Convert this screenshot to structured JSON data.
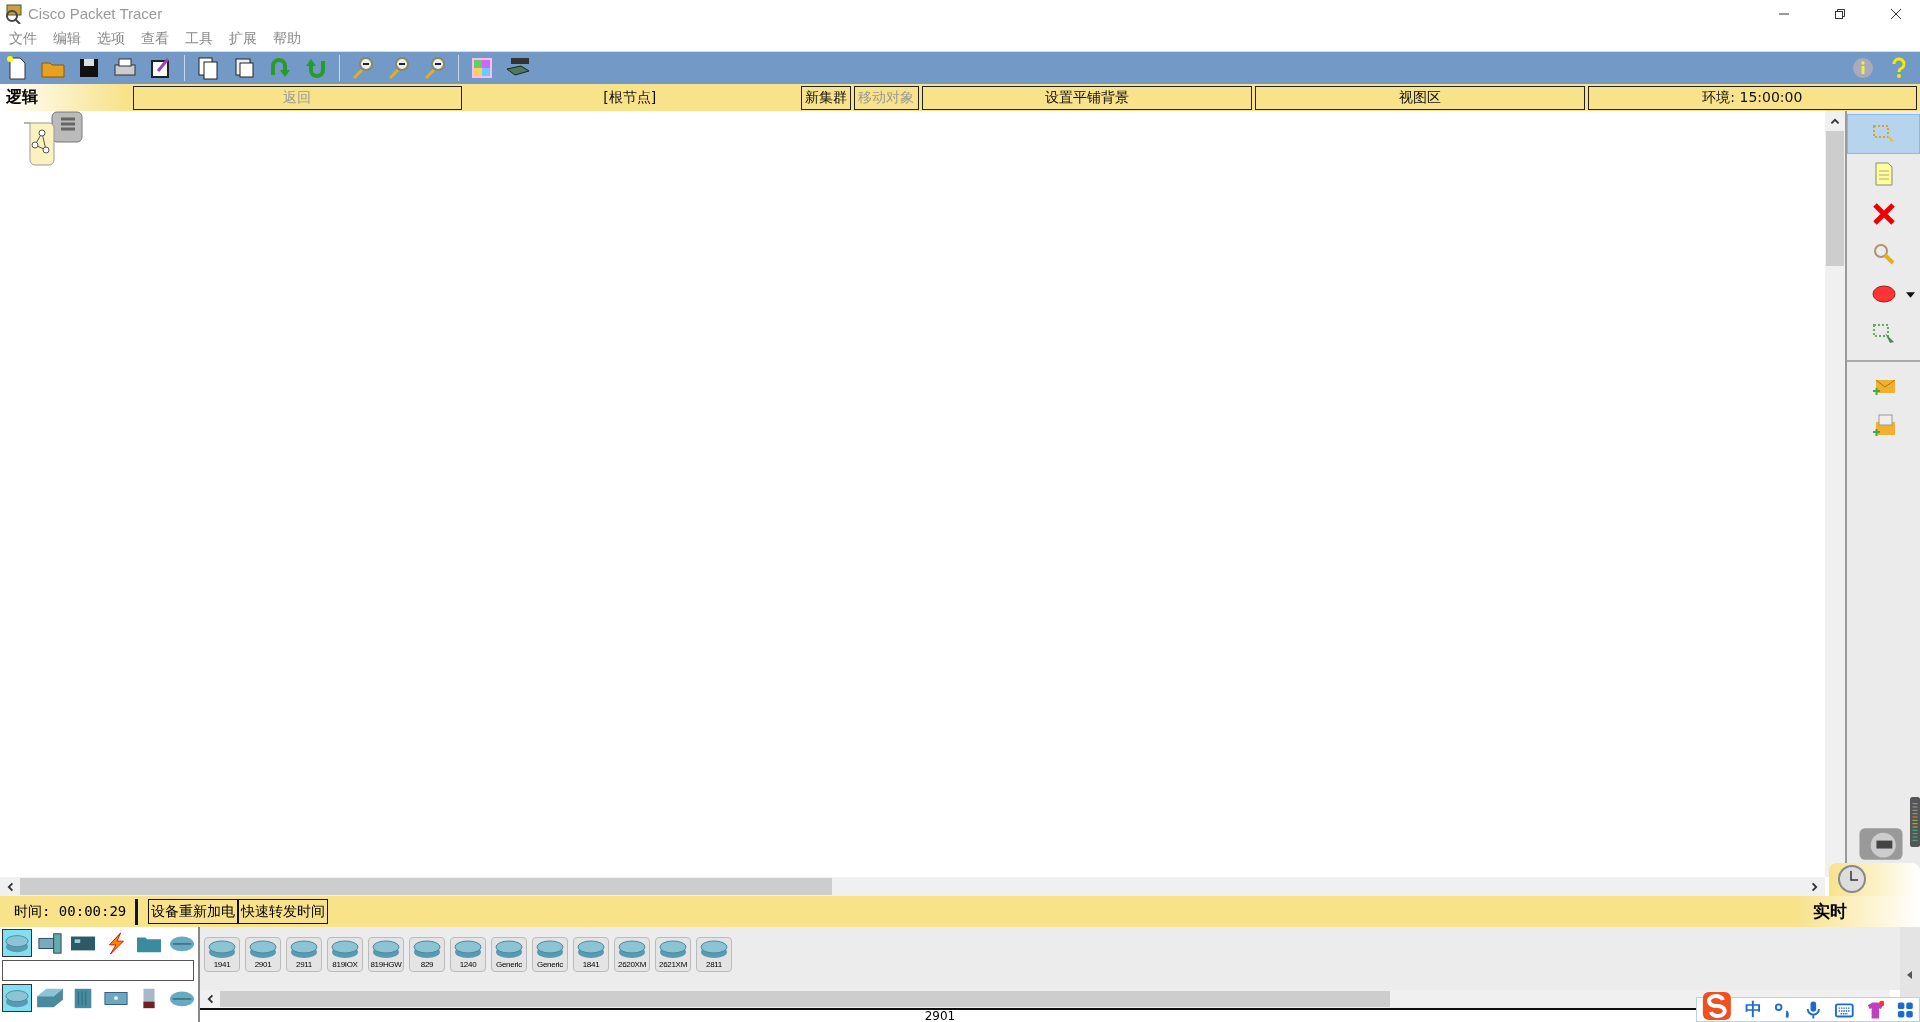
{
  "window": {
    "title": "Cisco Packet Tracer"
  },
  "menu": [
    "文件",
    "编辑",
    "选项",
    "查看",
    "工具",
    "扩展",
    "帮助"
  ],
  "toolbar": [
    {
      "kind": "new"
    },
    {
      "kind": "open"
    },
    {
      "kind": "save"
    },
    {
      "kind": "print"
    },
    {
      "kind": "wizard"
    },
    {
      "kind": "sep"
    },
    {
      "kind": "copy"
    },
    {
      "kind": "paste"
    },
    {
      "kind": "undo"
    },
    {
      "kind": "redo"
    },
    {
      "kind": "sep"
    },
    {
      "kind": "zoomin"
    },
    {
      "kind": "zoomreset"
    },
    {
      "kind": "zoomout"
    },
    {
      "kind": "sep"
    },
    {
      "kind": "palette"
    },
    {
      "kind": "device"
    }
  ],
  "nav_bar": {
    "workspace_tab": "逻辑",
    "items": [
      {
        "kind": "button",
        "label": "返回",
        "disabled": true
      },
      {
        "kind": "text",
        "label": "[根节点]",
        "disabled": false
      },
      {
        "kind": "button",
        "label": "新集群",
        "disabled": false
      },
      {
        "kind": "button",
        "label": "移动对象",
        "disabled": true
      },
      {
        "kind": "button",
        "label": "设置平铺背景",
        "disabled": false
      },
      {
        "kind": "button",
        "label": "视图区",
        "disabled": false
      },
      {
        "kind": "button",
        "label": "环境: 15:00:00",
        "disabled": false
      }
    ]
  },
  "right_tools": [
    {
      "kind": "select",
      "selected": true
    },
    {
      "kind": "note",
      "selected": false
    },
    {
      "kind": "delete",
      "selected": false
    },
    {
      "kind": "inspect",
      "selected": false
    },
    {
      "kind": "shape",
      "selected": false
    },
    {
      "kind": "resize",
      "selected": false
    },
    {
      "kind": "sep"
    },
    {
      "kind": "pdu",
      "selected": false
    },
    {
      "kind": "complex-pdu",
      "selected": false
    }
  ],
  "time_bar": {
    "time": "时间: 00:00:29",
    "buttons": [
      "设备重新加电",
      "快速转发时间"
    ],
    "mode_tab": "实时"
  },
  "device_panel": {
    "categories": [
      {
        "kind": "network",
        "selected": true
      },
      {
        "kind": "enddevice",
        "selected": false
      },
      {
        "kind": "component",
        "selected": false
      },
      {
        "kind": "connection",
        "selected": false
      },
      {
        "kind": "folder",
        "selected": false
      },
      {
        "kind": "cloud",
        "selected": false
      }
    ],
    "subcategories": [
      {
        "kind": "router",
        "selected": true
      },
      {
        "kind": "switch",
        "selected": false
      },
      {
        "kind": "hub",
        "selected": false
      },
      {
        "kind": "wireless",
        "selected": false
      },
      {
        "kind": "security",
        "selected": false
      },
      {
        "kind": "wan",
        "selected": false
      }
    ],
    "devices": [
      "1941",
      "2901",
      "2911",
      "819IOX",
      "819HGW",
      "829",
      "1240",
      "Generic",
      "Generic",
      "1841",
      "2620XM",
      "2621XM",
      "2811"
    ],
    "selected_model": "2901"
  },
  "ime_toolbar": {
    "mode": "中"
  }
}
